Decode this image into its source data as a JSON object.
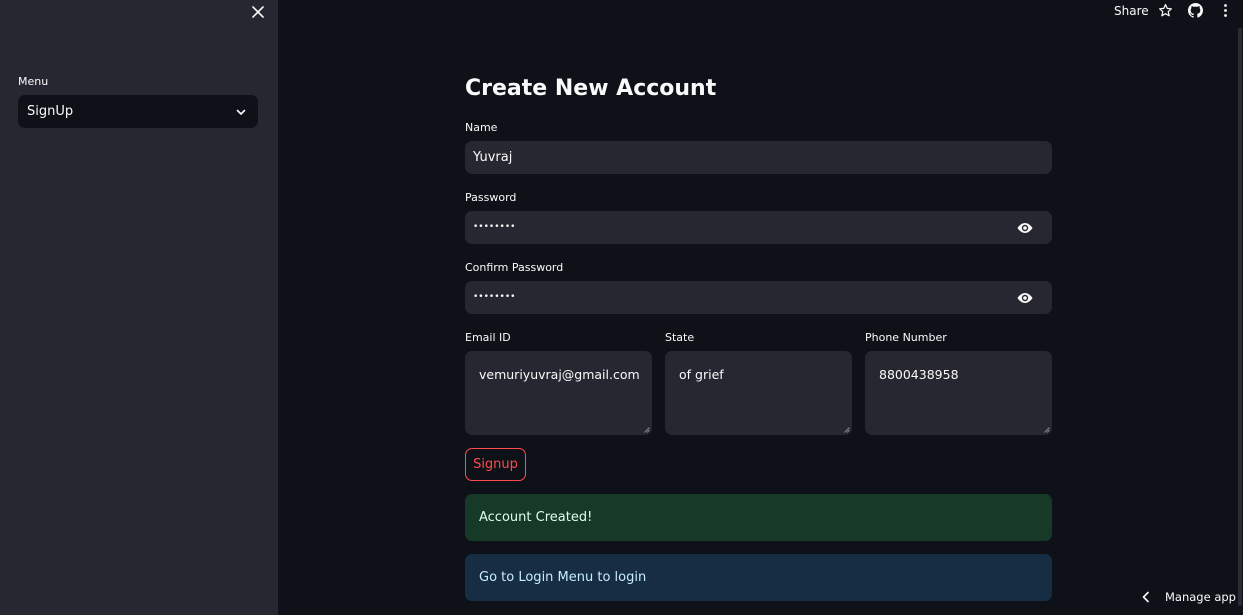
{
  "sidebar": {
    "close_icon": "close-icon",
    "menu_label": "Menu",
    "menu_selected": "SignUp",
    "menu_chevron_icon": "chevron-down-icon"
  },
  "toolbar": {
    "share_label": "Share",
    "star_icon": "star-icon",
    "github_icon": "github-icon",
    "more_icon": "more-vertical-icon"
  },
  "form": {
    "title": "Create New Account",
    "name": {
      "label": "Name",
      "value": "Yuvraj"
    },
    "password": {
      "label": "Password",
      "masked": "••••••••",
      "icon": "eye-icon"
    },
    "confirm_password": {
      "label": "Confirm Password",
      "masked": "••••••••",
      "icon": "eye-icon"
    },
    "email": {
      "label": "Email ID",
      "value": "vemuriyuvraj@gmail.com"
    },
    "state": {
      "label": "State",
      "value": "of grief"
    },
    "phone": {
      "label": "Phone Number",
      "value": "8800438958"
    },
    "signup_label": "Signup"
  },
  "alerts": {
    "success": "Account Created!",
    "info": "Go to Login Menu to login"
  },
  "footer": {
    "manage_app_label": "Manage app",
    "chevron_icon": "chevron-left-icon"
  },
  "colors": {
    "background": "#0e1117",
    "sidebar": "#262730",
    "input_bg": "#262730",
    "accent": "#ff4b4b",
    "success_bg": "#173928",
    "info_bg": "#172d43"
  }
}
